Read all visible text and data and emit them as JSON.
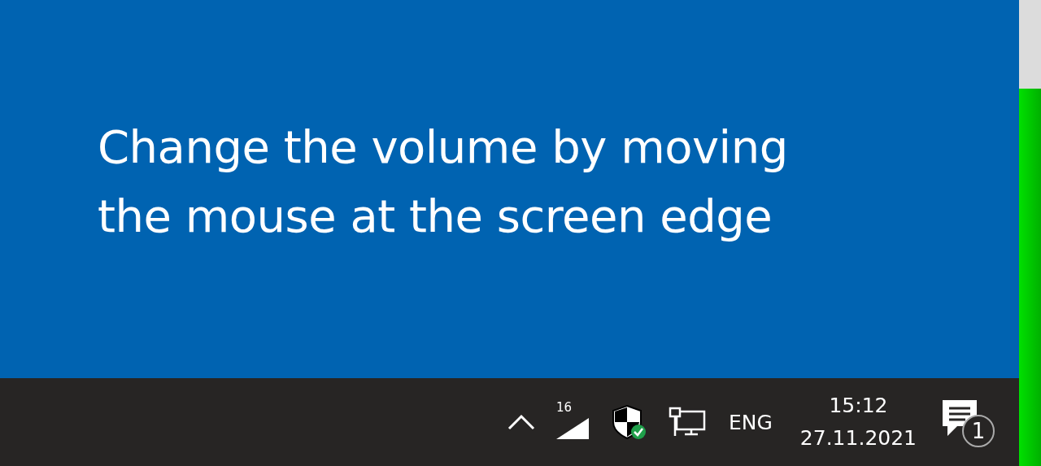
{
  "desktop": {
    "message": "Change the volume by moving the mouse at the screen edge"
  },
  "taskbar": {
    "signal_label": "16",
    "language": "ENG",
    "time": "15:12",
    "date": "27.11.2021",
    "notification_count": "1"
  },
  "volume_bar": {
    "level": 0.81
  }
}
